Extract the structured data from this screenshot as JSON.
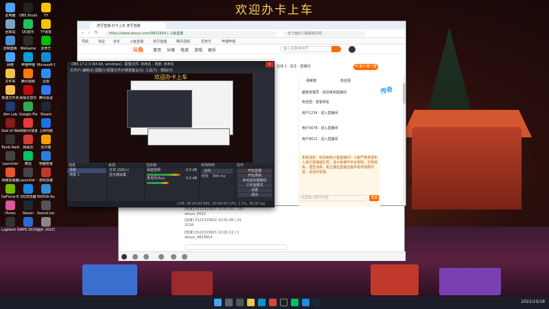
{
  "desktop": {
    "banner": "欢迎办卡上车",
    "icons": [
      {
        "label": "此电脑",
        "icon": "computer-icon",
        "color": "#4aa3ff"
      },
      {
        "label": "OBS Studio",
        "icon": "obs-icon",
        "color": "#222222"
      },
      {
        "label": "YY",
        "icon": "yy-icon",
        "color": "#f5c400"
      },
      {
        "label": "回收站",
        "icon": "recycle-bin-icon",
        "color": "#7aa7c7"
      },
      {
        "label": "QQ音乐",
        "icon": "qqmusic-icon",
        "color": "#20c35b"
      },
      {
        "label": "YY语音",
        "icon": "yy-voice-icon",
        "color": "#f5c400"
      },
      {
        "label": "控制面板",
        "icon": "control-panel-icon",
        "color": "#4a8fd0"
      },
      {
        "label": "WeGame",
        "icon": "wegame-icon",
        "color": "#2d2d2d"
      },
      {
        "label": "爱奇艺",
        "icon": "iqiyi-icon",
        "color": "#00be06"
      },
      {
        "label": "网络",
        "icon": "network-icon",
        "color": "#4aa3ff"
      },
      {
        "label": "哔哩哔哩",
        "icon": "bilibili-icon",
        "color": "#00a1d6"
      },
      {
        "label": "Microsoft Edge",
        "icon": "edge-icon",
        "color": "#0f8fd0"
      },
      {
        "label": "文件夹",
        "icon": "folder-icon",
        "color": "#f2c14e"
      },
      {
        "label": "腾讯视频",
        "icon": "tencent-video-icon",
        "color": "#ff7a00"
      },
      {
        "label": "迅雷",
        "icon": "xunlei-icon",
        "color": "#2d8cf0"
      },
      {
        "label": "新建文件夹",
        "icon": "folder-icon",
        "color": "#f2c14e"
      },
      {
        "label": "网易云音乐",
        "icon": "netease-music-icon",
        "color": "#c20c0c"
      },
      {
        "label": "腾讯会议",
        "icon": "meeting-icon",
        "color": "#2e7cf6"
      },
      {
        "label": "Aim Lab",
        "icon": "aimlab-icon",
        "color": "#1f3b73"
      },
      {
        "label": "Google Play",
        "icon": "play-icon",
        "color": "#34a853"
      },
      {
        "label": "Steam",
        "icon": "steam-icon",
        "color": "#1b2838"
      },
      {
        "label": "God of War",
        "icon": "game-icon",
        "color": "#8b1a1a"
      },
      {
        "label": "网易UU加速器",
        "icon": "uu-icon",
        "color": "#e83a3a"
      },
      {
        "label": "上网导航",
        "icon": "ie-icon",
        "color": "#1a73e8"
      },
      {
        "label": "Tomb Raider",
        "icon": "tr-icon",
        "color": "#333333"
      },
      {
        "label": "网易云",
        "icon": "cloud-icon",
        "color": "#d43c33"
      },
      {
        "label": "向日葵",
        "icon": "sunflower-icon",
        "color": "#f6a000"
      },
      {
        "label": "Launcher",
        "icon": "launcher-icon",
        "color": "#444444"
      },
      {
        "label": "微信",
        "icon": "wechat-icon",
        "color": "#07c160"
      },
      {
        "label": "电脑管家",
        "icon": "pc-manager-icon",
        "color": "#2a7de1"
      },
      {
        "label": "网络加速器",
        "icon": "speed-icon",
        "color": "#e4572e"
      },
      {
        "label": "Launcher 一键搞定",
        "icon": "launcher2-icon",
        "color": "#444444"
      },
      {
        "label": "游戏加速",
        "icon": "booster-icon",
        "color": "#c0392b"
      },
      {
        "label": "GeForce Experience",
        "icon": "nvidia-icon",
        "color": "#76b900"
      },
      {
        "label": "QQ浏览器",
        "icon": "qq-browser-icon",
        "color": "#1e88e5"
      },
      {
        "label": "NVIDIA Audio",
        "icon": "nvidia-audio-icon",
        "color": "#2f8fd8"
      },
      {
        "label": "iTunes",
        "icon": "itunes-icon",
        "color": "#e0569b"
      },
      {
        "label": "Steam",
        "icon": "steam-icon",
        "color": "#1b2838"
      },
      {
        "label": "Sound Lock",
        "icon": "sound-lock-icon",
        "color": "#555555"
      },
      {
        "label": "Logitech G HUB",
        "icon": "logitech-icon",
        "color": "#333333"
      },
      {
        "label": "WPS 2019",
        "icon": "wps-icon",
        "color": "#2c6bd6"
      },
      {
        "label": "图片 20221018...",
        "icon": "image-file-icon",
        "color": "#888888"
      }
    ],
    "clock": "2022/10/18"
  },
  "browser": {
    "tab_title": "虎牙直播-办卡上车 虎牙直播",
    "url": "https://www.douyu.com/9821954 | 斗鱼直播",
    "search_placeholder": "台下面的小姐姐就这样...",
    "bookmarks": [
      "导航",
      "淘宝",
      "京东",
      "斗鱼直播",
      "虎牙直播",
      "腾讯视频",
      "爱奇艺",
      "哔哩哔哩"
    ],
    "nav": [
      "首页",
      "分类",
      "电竞",
      "游戏",
      "娱乐"
    ],
    "site_logo": "斗鱼",
    "site_search_placeholder": "输入主播/房间号",
    "room_info": "在线 2 · 关注 · 直播间",
    "pc_button": "PC客户端下载",
    "chat_tabs": [
      "贡献榜",
      "粉丝团"
    ],
    "chat_lines": [
      "超级管理员 · 欢迎来到直播间",
      "粉丝团 · 查看排名",
      "用户1234 · 进入直播间",
      "用户5678 · 进入直播间",
      "用户9012 · 进入直播间"
    ],
    "notice": "系统消息：欢迎来到斗鱼直播间！斗鱼严禁未成年人进行直播或打赏，请大家遵守平台规则，文明观看，理性消费。如主播在直播过程中发布违规内容，请及时举报。",
    "chat_placeholder": "这里输入聊天内容",
    "send_label": "发送",
    "game_badge": "传奇",
    "lower_chat": [
      "[玩家] 0121315821 10:01:05 | 100",
      "douyu_9522",
      "[玩家] 0121315821 10:01:08 | 10",
      "101A",
      "[玩家] 0121315821 10:01:12 | 1",
      "douyu_9623814"
    ]
  },
  "obs": {
    "title": "OBS 27.2.3 (64-bit, windows) - 配置文件: 未命名 - 场景: 未命名",
    "menu": [
      "文件(F)",
      "编辑(E)",
      "视图(V)",
      "配置文件(P)",
      "场景集合(S)",
      "工具(T)",
      "帮助(H)"
    ],
    "preview_banner": "欢迎办卡上车",
    "docks": {
      "scenes_title": "场景",
      "scenes": [
        "场景",
        "场景 2"
      ],
      "sources_title": "来源",
      "sources": [
        "文本 (GDI+)",
        "显示器采集"
      ],
      "mixer_title": "混音器",
      "mixer": [
        {
          "name": "桌面音频",
          "db": "0.0 dB",
          "level": 0.7
        },
        {
          "name": "麦克风/Aux",
          "db": "0.0 dB",
          "level": 0.45
        }
      ],
      "transition_title": "转场特效",
      "transition_value": "淡出",
      "duration_label": "时长",
      "duration_value": "300 ms",
      "controls_title": "控件",
      "controls": [
        "开始直播",
        "开始录制",
        "启动虚拟摄像机",
        "工作室模式",
        "设置",
        "退出"
      ]
    },
    "status": "LIVE: 00:00:00   REC: 00:00:00   CPU: 1.5%, 30.00 fps"
  }
}
